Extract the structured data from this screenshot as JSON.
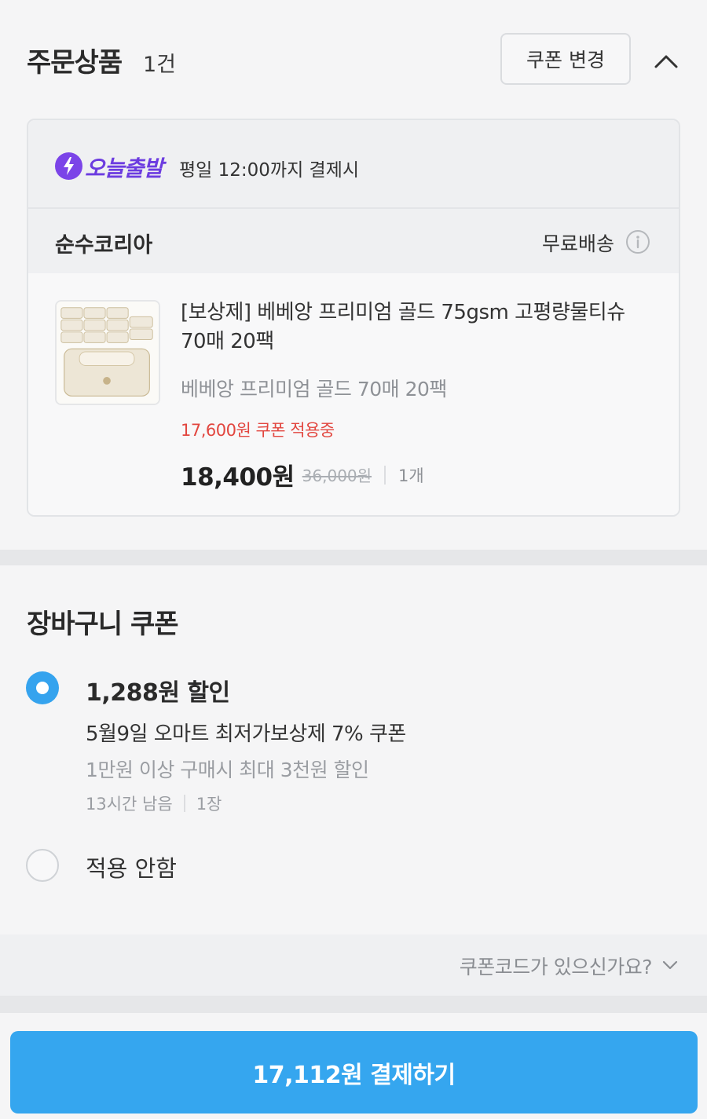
{
  "order": {
    "title": "주문상품",
    "count": "1건",
    "coupon_change_label": "쿠폰 변경",
    "collapse_icon": "chevron-up-icon"
  },
  "delivery": {
    "badge_label": "오늘출발",
    "badge_icon": "lightning-bolt-icon",
    "description": "평일 12:00까지 결제시"
  },
  "seller": {
    "name": "순수코리아",
    "shipping": "무료배송",
    "info_icon": "info-icon"
  },
  "product": {
    "name": "[보상제] 베베앙 프리미엄 골드 75gsm 고평량물티슈 70매 20팩",
    "option": "베베앙 프리미엄 골드 70매 20팩",
    "coupon_applied": "17,600원 쿠폰 적용중",
    "sale_price": "18,400원",
    "original_price": "36,000원",
    "quantity": "1개"
  },
  "cart_coupon": {
    "title": "장바구니 쿠폰",
    "options": [
      {
        "discount": "1,288원 할인",
        "name": "5월9일 오마트 최저가보상제 7% 쿠폰",
        "condition": "1만원 이상 구매시 최대 3천원 할인",
        "time_left": "13시간 남음",
        "count": "1장",
        "selected": true
      },
      {
        "label": "적용 안함",
        "selected": false
      }
    ]
  },
  "coupon_code": {
    "toggle_label": "쿠폰코드가 있으신가요?"
  },
  "payment": {
    "button_label": "17,112원 결제하기"
  },
  "colors": {
    "accent_blue": "#35a6ef",
    "coupon_red": "#e2463f",
    "today_purple": "#6c3ce0"
  }
}
